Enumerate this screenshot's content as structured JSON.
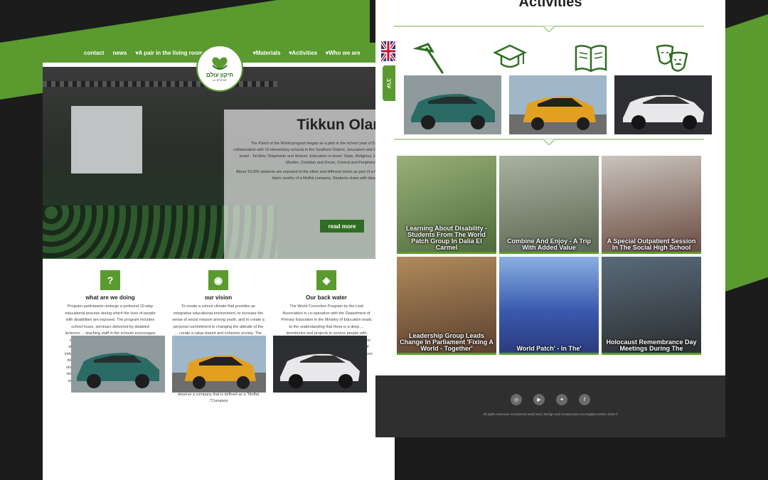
{
  "colors": {
    "brand_green": "#5a9a2e",
    "dark_green": "#2e6e22",
    "background": "#1c1c1c",
    "footer": "#2f2f2f"
  },
  "nav": {
    "items": [
      "contact",
      "news",
      "A pair in the living room",
      "Materials",
      "Activities",
      "Who we are"
    ]
  },
  "logo": {
    "name": "תיקון עולם",
    "sub": "on ישראלים"
  },
  "side_badge": "ערב",
  "hero": {
    "title": "Tikkun Olam",
    "paragraph1": "The Patch of the World program began as a pilot in the school year of 5780, in collaboration with 10 elementary schools in the Southern District, Jerusalem and Central Israel - Tel Aviv, Shephelah and Sharon. Education in Israel: State, Religious, Haredi, Muslim, Christian and Druze, Central and Periphery Cities",
    "paragraph2": "About 10,000 students are exposed to the other and different vision as part of a human fabric worthy of a Moffat company. Students share with disabilities",
    "read_more": "read more"
  },
  "features": [
    {
      "icon": "?",
      "title": "what are we doing",
      "text": "Program participants undergo a profound 10-step educational process during which the lives of people with disabilities are exposed. The program includes school hours, seminars delivered by disabled lecturers ... teaching staff in the schools encourages educational activities, volunteering and various student-led initiatives, so dozens of independent initiatives have been created to integrate people with disabilities, shared volunteering, creativity, shared study hours and trips. At the end of the program - 5 steps are taking place across the country - to raise awareness and promote the rights of people with disabilities"
    },
    {
      "icon": "◉",
      "title": "our vision",
      "text": "To create a school climate that provides an integrative educational environment, to increase the sense of social mission among youth, and to create a personal commitment to changing the attitude of the ... create a value-based and cohesive society. The program's circle of influence will be expanded beyond the school boundaries, for all youth in Israel, one that will sweep families, youth movements and student councils - to a significant and wide-ranging effort that will increase the voluntary system to a large extent and significantly impact people with disabilities in all walks of life: the IDF, in the academy and in the labor market, this is how we will rightfully deserve a company that is defined as a \"Moffat .\"Company"
    },
    {
      "icon": "◈",
      "title": "Our back water",
      "text": "The World Correction Program by the Leaf Association in co-operation with the Department of Primary Education in the Ministry of Education leads to the understanding that there is a deep ... dormitories and projects to service people with disabilities, believing that every child, despite his or her disabilities, has the right to the best quality of .life, alongside worthy, dedication and boundless love"
    }
  ],
  "activities": {
    "title": "Activities",
    "icons": [
      "hammer-icon",
      "graduation-cap-icon",
      "book-icon",
      "theater-masks-icon"
    ],
    "gallery": [
      {
        "caption": "Learning About Disability - Students From The World Patch Group In Dalia El Carmel",
        "photo_color": "#6f8c5a"
      },
      {
        "caption": "Combine And Enjoy - A Trip With Added Value",
        "photo_color": "#7d8a75"
      },
      {
        "caption": "A Special Outpatient Session In The Social High School",
        "photo_color": "#8a5a4f"
      },
      {
        "caption": "Leadership Group Leads Change In Parliament 'Fixing A World - Together'",
        "photo_color": "#8a6a4a"
      },
      {
        "caption": "World Patch' - In The'",
        "photo_color": "#2f4f9a"
      },
      {
        "caption": "Holocaust Remembrance Day Meetings During The",
        "photo_color": "#4a5a5e"
      }
    ]
  },
  "footer": {
    "social": [
      "instagram-icon",
      "youtube-icon",
      "twitter-icon",
      "facebook-icon"
    ],
    "copyright": "All rights reserved Amendment world leaf | Design and Construction Ace Digital London 2019 ©"
  }
}
